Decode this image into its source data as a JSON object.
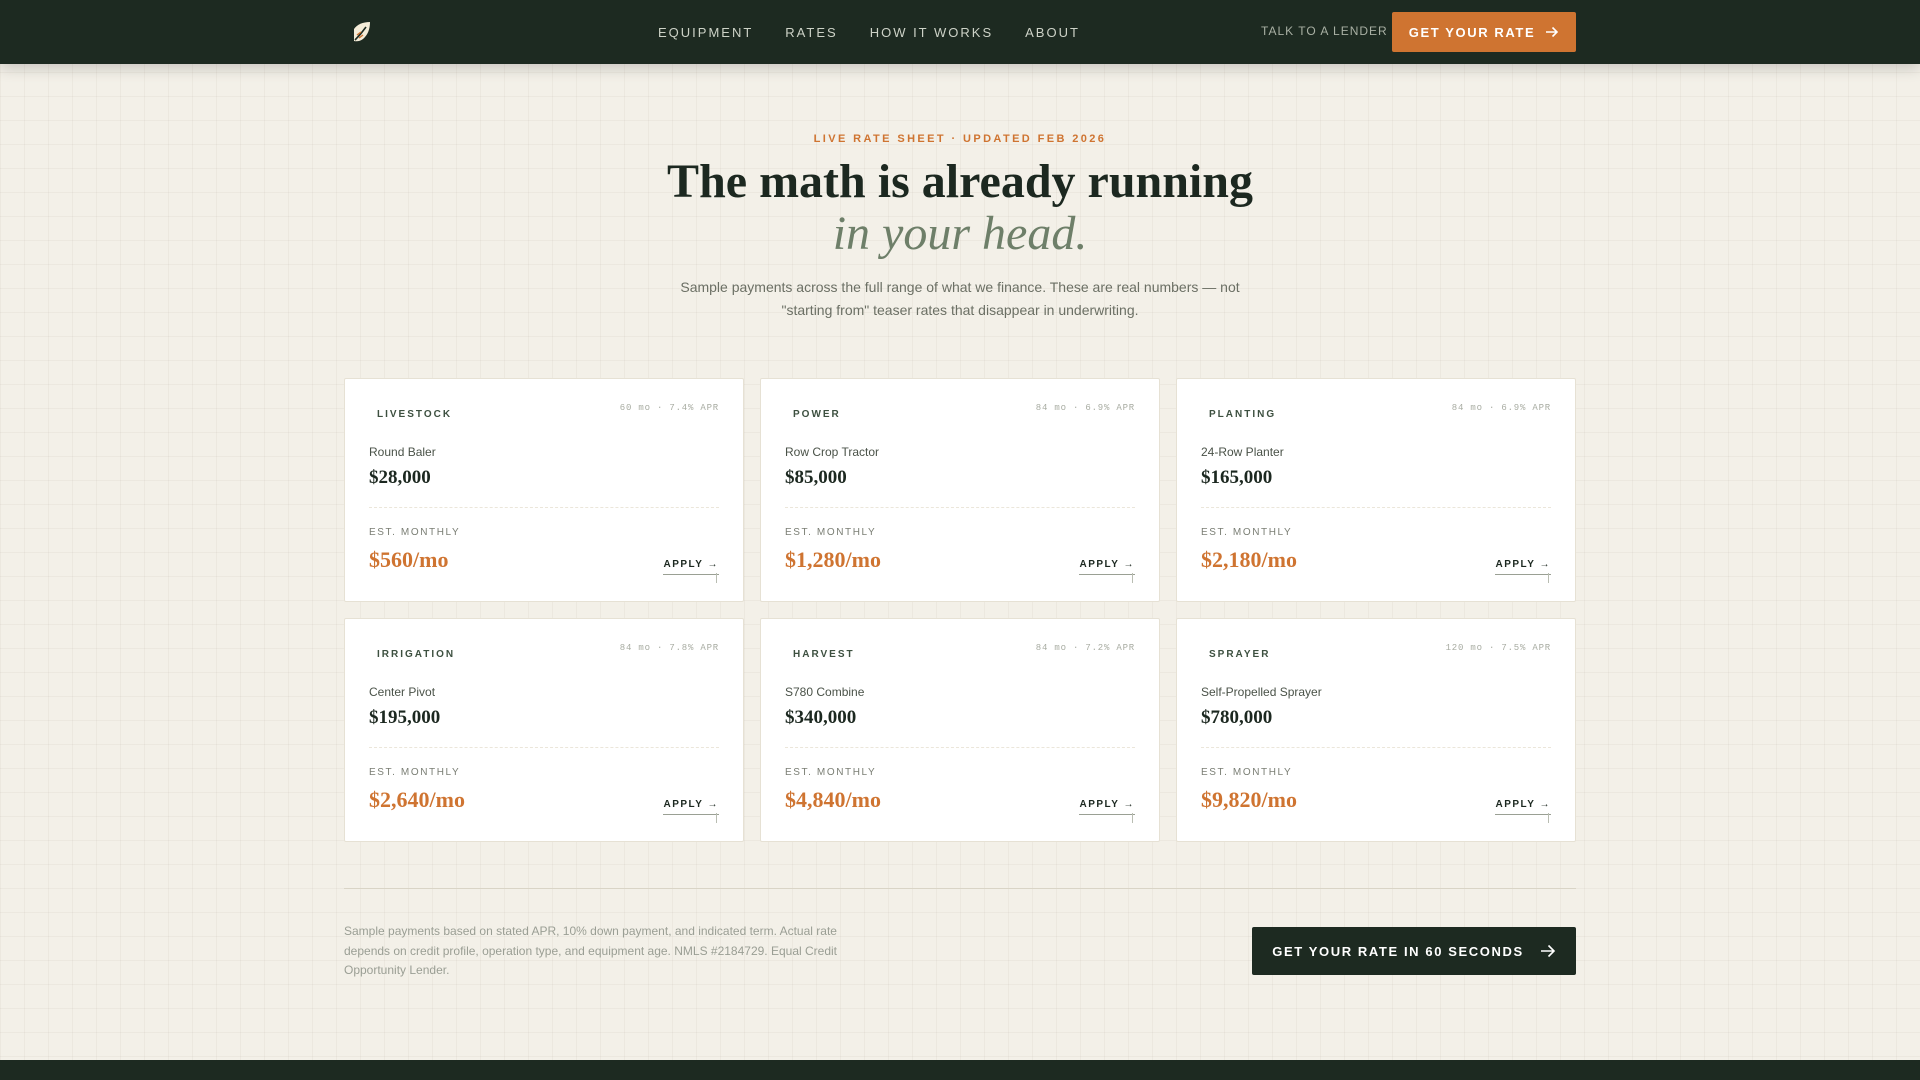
{
  "nav": {
    "links": [
      "EQUIPMENT",
      "RATES",
      "HOW IT WORKS",
      "ABOUT"
    ],
    "talk_label": "TALK TO A LENDER",
    "cta_label": "GET YOUR RATE"
  },
  "hero": {
    "eyebrow": "LIVE RATE SHEET · UPDATED FEB 2026",
    "headline": "The math is already running",
    "headline_em": "in your head.",
    "subtitle": "Sample payments across the full range of what we finance. These are real numbers — not \"starting from\" teaser rates that disappear in underwriting."
  },
  "cards": [
    {
      "category": "LIVESTOCK",
      "terms": "60 mo · 7.4% APR",
      "item": "Round Baler",
      "price": "$28,000",
      "est_label": "EST. MONTHLY",
      "monthly": "$560/mo",
      "apply": "APPLY →"
    },
    {
      "category": "POWER",
      "terms": "84 mo · 6.9% APR",
      "item": "Row Crop Tractor",
      "price": "$85,000",
      "est_label": "EST. MONTHLY",
      "monthly": "$1,280/mo",
      "apply": "APPLY →"
    },
    {
      "category": "PLANTING",
      "terms": "84 mo · 6.9% APR",
      "item": "24-Row Planter",
      "price": "$165,000",
      "est_label": "EST. MONTHLY",
      "monthly": "$2,180/mo",
      "apply": "APPLY →"
    },
    {
      "category": "IRRIGATION",
      "terms": "84 mo · 7.8% APR",
      "item": "Center Pivot",
      "price": "$195,000",
      "est_label": "EST. MONTHLY",
      "monthly": "$2,640/mo",
      "apply": "APPLY →"
    },
    {
      "category": "HARVEST",
      "terms": "84 mo · 7.2% APR",
      "item": "S780 Combine",
      "price": "$340,000",
      "est_label": "EST. MONTHLY",
      "monthly": "$4,840/mo",
      "apply": "APPLY →"
    },
    {
      "category": "SPRAYER",
      "terms": "120 mo · 7.5% APR",
      "item": "Self-Propelled Sprayer",
      "price": "$780,000",
      "est_label": "EST. MONTHLY",
      "monthly": "$9,820/mo",
      "apply": "APPLY →"
    }
  ],
  "footer": {
    "disclaimer": "Sample payments based on stated APR, 10% down payment, and indicated term. Actual rate depends on credit profile, operation type, and equipment age. NMLS #2184729. Equal Credit Opportunity Lender.",
    "cta_label": "GET YOUR RATE IN 60 SECONDS"
  },
  "icons": {
    "logo": "leaf-logo-icon",
    "cta_arrow": "arrow-right-icon"
  },
  "colors": {
    "accent": "#cf7431",
    "dark": "#1d2a21",
    "background": "#f3f0e8"
  }
}
